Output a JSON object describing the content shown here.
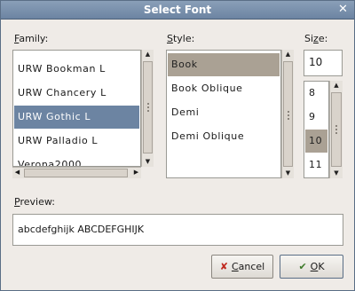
{
  "window": {
    "title": "Select Font",
    "close_glyph": "✕"
  },
  "family": {
    "label_mnemonic": "F",
    "label_rest": "amily:",
    "items": [
      "URW Bookman L",
      "URW Chancery L",
      "URW Gothic L",
      "URW Palladio L",
      "Verona2000"
    ],
    "selected": "URW Gothic L"
  },
  "style": {
    "label_mnemonic": "S",
    "label_rest": "tyle:",
    "items": [
      "Book",
      "Book Oblique",
      "Demi",
      "Demi Oblique"
    ],
    "selected": "Book"
  },
  "size": {
    "label_prefix": "Si",
    "label_mnemonic": "z",
    "label_rest": "e:",
    "value": "10",
    "items": [
      "8",
      "9",
      "10",
      "11"
    ],
    "selected": "10"
  },
  "preview": {
    "label_mnemonic": "P",
    "label_rest": "review:",
    "text": "abcdefghijk ABCDEFGHIJK"
  },
  "buttons": {
    "cancel_mnemonic": "C",
    "cancel_rest": "ancel",
    "ok_mnemonic": "O",
    "ok_rest": "K"
  },
  "colors": {
    "title_bar": "#6c84a2",
    "selection": "#6c84a2",
    "selection_inactive": "#aaa194"
  }
}
